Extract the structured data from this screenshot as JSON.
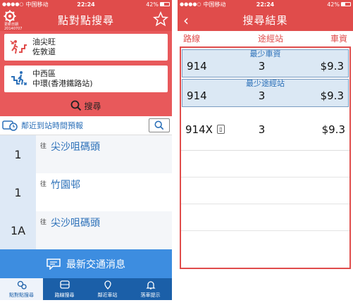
{
  "status_left": {
    "carrier": "中国移动",
    "time": "22:24",
    "battery": "42%"
  },
  "status_right": {
    "carrier": "中国移动",
    "time": "22:24",
    "battery": "42%"
  },
  "left": {
    "header": {
      "title": "點對點搜尋",
      "update_label": "更新日期",
      "update_date": "20140707"
    },
    "origin": {
      "line1": "油尖旺",
      "line2": "佐敦道"
    },
    "destination": {
      "line1": "中西區",
      "line2": "中環(香港鐵路站)"
    },
    "search_label": "搜尋",
    "nearby_label": "鄰近到站時間預報",
    "rows": [
      {
        "route": "1",
        "to": "往",
        "dest": "尖沙咀碼頭"
      },
      {
        "route": "1",
        "to": "往",
        "dest": "竹園邨"
      },
      {
        "route": "1A",
        "to": "往",
        "dest": "尖沙咀碼頭"
      }
    ],
    "news_label": "最新交通消息",
    "tabs": [
      "點對點搜尋",
      "路線搜尋",
      "鄰近車站",
      "落車提示"
    ]
  },
  "right": {
    "header": {
      "title": "搜尋結果"
    },
    "columns": {
      "route": "路線",
      "stops": "途經站",
      "fare": "車資"
    },
    "results": [
      {
        "tag": "最少車資",
        "route": "914",
        "stops": "3",
        "fare": "$9.3"
      },
      {
        "tag": "最少途經站",
        "route": "914",
        "stops": "3",
        "fare": "$9.3"
      },
      {
        "tag": "",
        "route": "914X",
        "stops": "3",
        "fare": "$9.3"
      }
    ]
  },
  "colors": {
    "accent_red": "#e04c4b",
    "blue": "#2a6fb8",
    "tab_blue": "#1b5fa8"
  }
}
